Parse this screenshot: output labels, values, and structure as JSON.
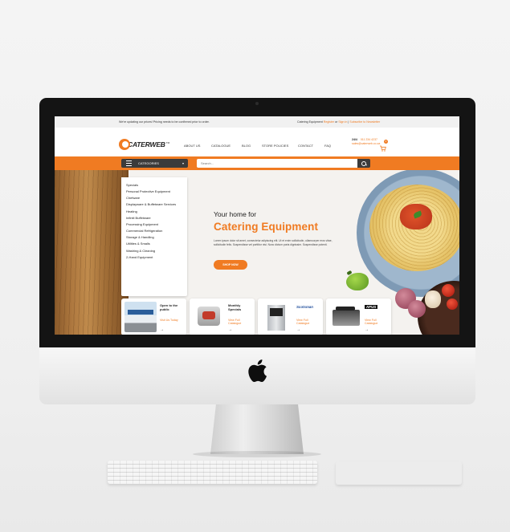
{
  "notice": {
    "left": "We're updating our prices! Pricing needs to be confirmed prior to order.",
    "right_prefix": "Catering Equipment",
    "register": "Register",
    "or": "or",
    "signin": "Sign in",
    "sep": "|",
    "subscribe": "Subscribe to Newsletter"
  },
  "logo": {
    "text": "CATERWEB",
    "tm": "TM"
  },
  "nav": [
    "ABOUT US",
    "CATALOGUE",
    "BLOG",
    "STORE POLICIES",
    "CONTACT",
    "FAQ"
  ],
  "contact": {
    "hours": "24/4",
    "phone": "011 234 4237",
    "email": "sales@caterweb.co.za"
  },
  "cart": {
    "count": "0"
  },
  "category_button": {
    "label": "CATEGORIES",
    "chevron": "▾"
  },
  "search": {
    "placeholder": "Search..."
  },
  "categories": [
    "Specials",
    "Personal Protective Equipment",
    "Chefware",
    "Displayware & Buffetware Services",
    "Heating",
    "Infiniti Buffetware",
    "Processing Equipment",
    "Commercial Refrigeration",
    "Storage & Handling",
    "Utilities & Smalls",
    "Washing & Cleaning",
    "2-Hand Equipment"
  ],
  "hero": {
    "subtitle": "Your home for",
    "title": "Catering Equipment",
    "body": "Lorem ipsum dolor sit amet, consectetur adipiscing elit. Ut et enim sollicitudin, ullamcorper eros vitae, sollicitudin felis. Suspendisse vel porttitor nisi. Nunc dictum porta dignissim. Suspendisse potenti.",
    "button": "SHOP NOW"
  },
  "cards": [
    {
      "title": "Open to the public",
      "link": "Visit Us Today",
      "arrow": "→"
    },
    {
      "title": "Monthly Specials",
      "link": "View Full Catalogue",
      "arrow": "→"
    },
    {
      "title": "",
      "brand": "Scotsman",
      "link": "View Full Catalogue",
      "arrow": "→"
    },
    {
      "title": "",
      "brand": "APUS",
      "link": "View Full Catalogue",
      "arrow": "→"
    }
  ],
  "colors": {
    "accent": "#f07b22",
    "dark": "#3b3b3b"
  },
  "icons": [
    "apple-icon",
    "hamburger-icon",
    "search-icon",
    "cart-icon",
    "arrow-right-icon"
  ]
}
